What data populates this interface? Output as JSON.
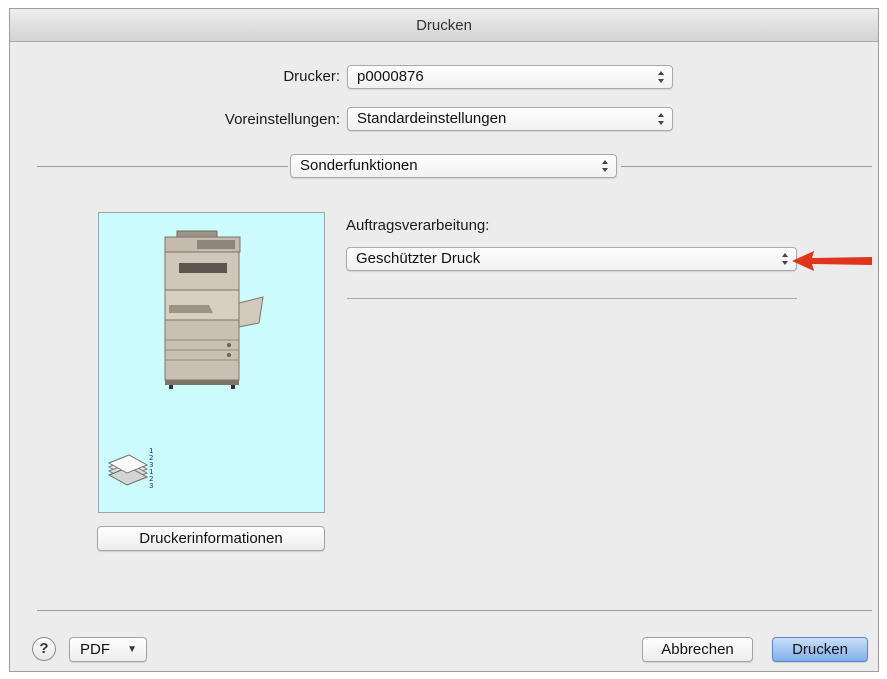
{
  "window": {
    "title": "Drucken"
  },
  "printer": {
    "label": "Drucker:",
    "value": "p0000876"
  },
  "presets": {
    "label": "Voreinstellungen:",
    "value": "Standardeinstellungen"
  },
  "panel_selector": {
    "value": "Sonderfunktionen"
  },
  "job_processing": {
    "label": "Auftragsverarbeitung:",
    "value": "Geschützter Druck"
  },
  "preview": {
    "stack_numbers": "1\n2\n3\n1\n2\n3"
  },
  "printer_info_button": "Druckerinformationen",
  "footer": {
    "help_label": "?",
    "pdf_label": "PDF",
    "cancel_label": "Abbrechen",
    "print_label": "Drucken"
  },
  "annotation": {
    "arrow_color": "#e0341c"
  },
  "icons": [
    "popup-arrows-icon",
    "printer-device-icon",
    "paper-stack-icon",
    "red-pointer-arrow-icon",
    "help-icon",
    "chevron-down-icon"
  ]
}
